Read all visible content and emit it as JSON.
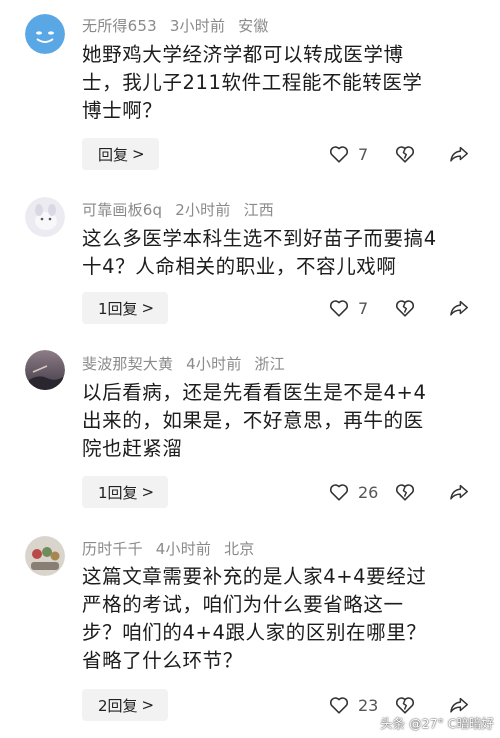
{
  "comments": [
    {
      "username": "无所得653",
      "time": "3小时前",
      "location": "安徽",
      "lines": [
        "她野鸡大学经济学都可以转成医学博",
        "士，我儿子211软件工程能不能转医学",
        "博士啊？"
      ],
      "reply_label": "回复",
      "likes": "7",
      "avatar_color": "#5aa7e6"
    },
    {
      "username": "可靠画板6q",
      "time": "2小时前",
      "location": "江西",
      "lines": [
        "这么多医学本科生选不到好苗子而要搞4",
        "十4？人命相关的职业，不容儿戏啊"
      ],
      "reply_label": "1回复",
      "likes": "7",
      "avatar_color": "#e9e6ef"
    },
    {
      "username": "斐波那契大黄",
      "time": "4小时前",
      "location": "浙江",
      "lines": [
        "以后看病，还是先看看医生是不是4+4",
        "出来的，如果是，不好意思，再牛的医",
        "院也赶紧溜"
      ],
      "reply_label": "1回复",
      "likes": "26",
      "avatar_color": "#7a6a72"
    },
    {
      "username": "历时千千",
      "time": "4小时前",
      "location": "北京",
      "lines": [
        "这篇文章需要补充的是人家4+4要经过",
        "严格的考试，咱们为什么要省略这一",
        "步？咱们的4+4跟人家的区别在哪里？",
        "省略了什么环节？"
      ],
      "reply_label": "2回复",
      "likes": "23",
      "avatar_color": "#c7c2b8"
    }
  ],
  "reply_chevron": ">",
  "icons": {
    "like": "heart-outline-icon",
    "dislike": "broken-heart-icon",
    "share": "share-arrow-icon"
  },
  "watermark": "头条 @27° C暗暗好"
}
